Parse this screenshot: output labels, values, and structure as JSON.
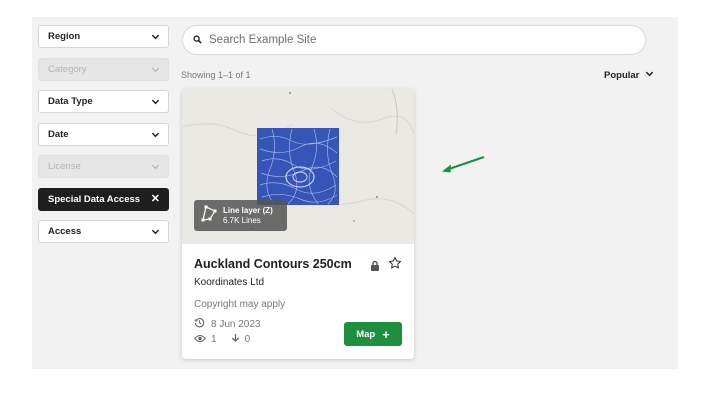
{
  "filters": [
    {
      "label": "Region",
      "state": "normal"
    },
    {
      "label": "Category",
      "state": "disabled"
    },
    {
      "label": "Data Type",
      "state": "normal"
    },
    {
      "label": "Date",
      "state": "normal"
    },
    {
      "label": "License",
      "state": "disabled"
    },
    {
      "label": "Special Data Access",
      "state": "active"
    },
    {
      "label": "Access",
      "state": "normal"
    }
  ],
  "search": {
    "placeholder": "Search Example Site",
    "value": ""
  },
  "results": {
    "showing": "Showing 1–1 of 1"
  },
  "sort": {
    "label": "Popular"
  },
  "card": {
    "layer_type": "Line layer (Z)",
    "layer_count": "6.7K Lines",
    "title": "Auckland Contours 250cm",
    "publisher": "Koordinates Ltd",
    "copyright": "Copyright may apply",
    "date": "8 Jun 2023",
    "views": "1",
    "downloads": "0",
    "map_button": "Map"
  },
  "colors": {
    "accent_green": "#1e8f3f",
    "active_filter": "#1f1f1f",
    "map_lines": "#2a4fb0"
  }
}
